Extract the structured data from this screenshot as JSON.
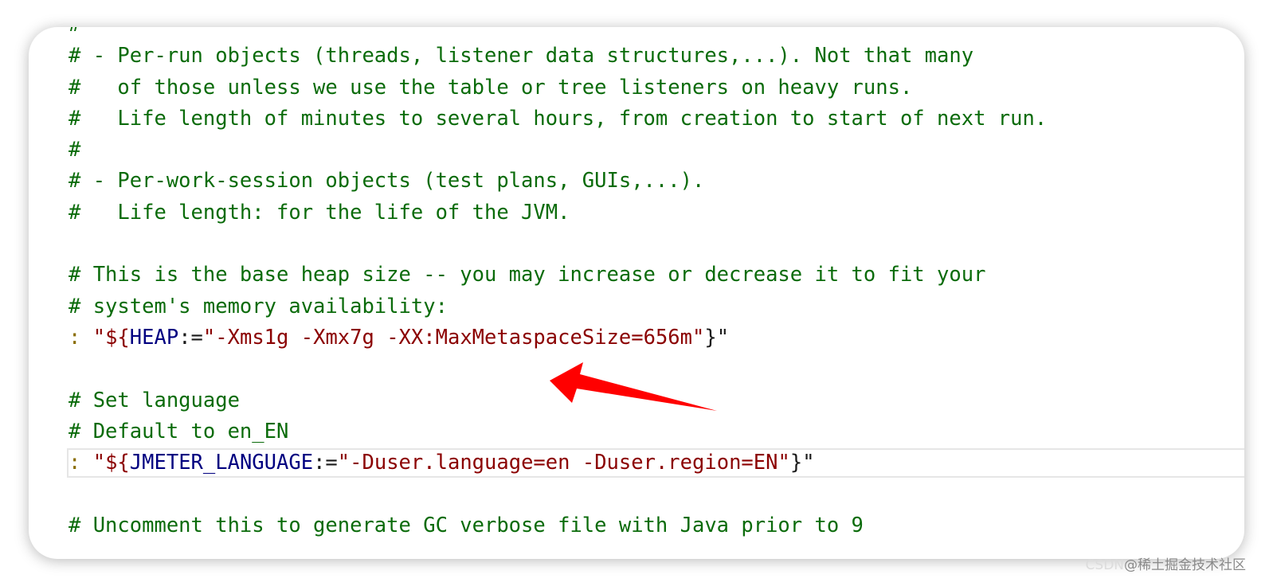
{
  "code_lines": [
    {
      "text": "#"
    },
    {
      "text": "# - Per-run objects (threads, listener data structures,...). Not that many"
    },
    {
      "text": "#   of those unless we use the table or tree listeners on heavy runs."
    },
    {
      "text": "#   Life length of minutes to several hours, from creation to start of next run."
    },
    {
      "text": "#"
    },
    {
      "text": "# - Per-work-session objects (test plans, GUIs,...)."
    },
    {
      "text": "#   Life length: for the life of the JVM."
    },
    {
      "text": ""
    },
    {
      "text": "# This is the base heap size -- you may increase or decrease it to fit your"
    },
    {
      "text": "# system's memory availability:"
    },
    {
      "heap_line": {
        "prefix": ": ",
        "open": "\"${",
        "var": "HEAP",
        "op": ":=",
        "value": "\"-Xms1g -Xmx7g -XX:MaxMetaspaceSize=656m\"",
        "close": "}\""
      }
    },
    {
      "text": ""
    },
    {
      "text": "# Set language"
    },
    {
      "text": "# Default to en_EN"
    },
    {
      "lang_line": {
        "prefix": ": ",
        "open": "\"${",
        "var": "JMETER_LANGUAGE",
        "op": ":=",
        "value": "\"-Duser.language=en -Duser.region=EN\"",
        "close": "}\""
      }
    },
    {
      "text": ""
    },
    {
      "text": "# Uncomment this to generate GC verbose file with Java prior to 9"
    }
  ],
  "colors": {
    "comment": "#0a6b0a",
    "string": "#8b0000",
    "variable": "#000080",
    "arrow": "#ff0000"
  },
  "watermark": {
    "faint": "CSDN",
    "text": "@稀土掘金技术社区"
  }
}
